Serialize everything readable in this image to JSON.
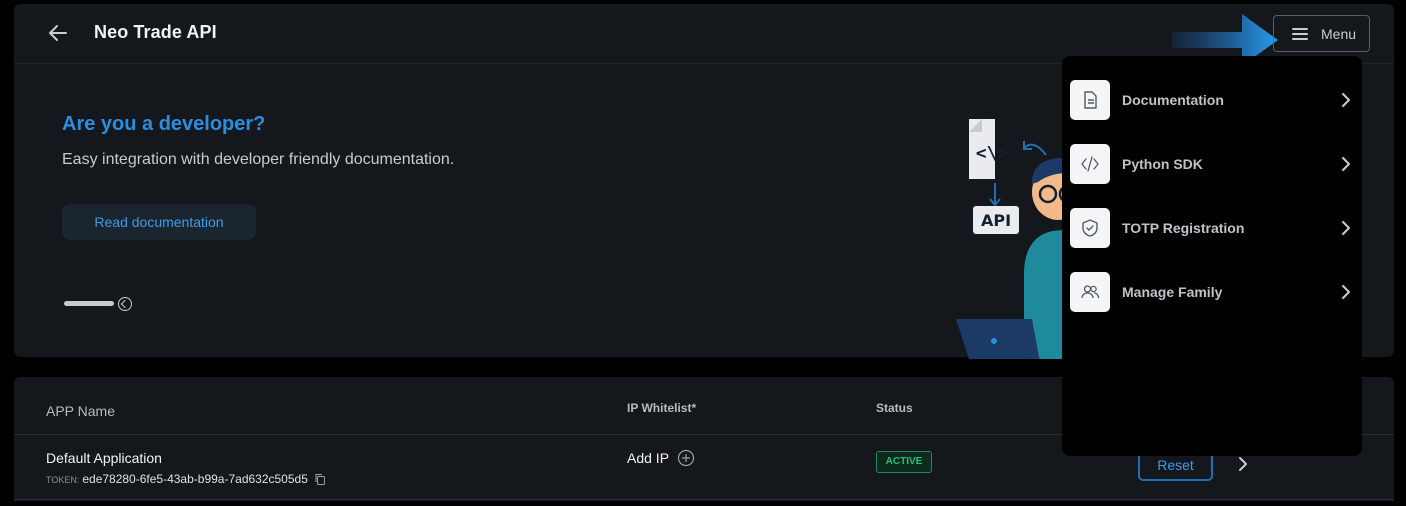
{
  "header": {
    "title": "Neo Trade API",
    "back_icon": "arrow-left-icon",
    "menu_label": "Menu"
  },
  "banner": {
    "title": "Are you a developer?",
    "subtitle": "Easy integration with developer friendly documentation.",
    "button_label": "Read documentation",
    "illustration_code_label": "<\\>",
    "illustration_api_label": "API"
  },
  "menu": {
    "items": [
      {
        "label": "Documentation",
        "icon": "document-icon"
      },
      {
        "label": "Python SDK",
        "icon": "code-icon"
      },
      {
        "label": "TOTP Registration",
        "icon": "shield-icon"
      },
      {
        "label": "Manage Family",
        "icon": "users-icon"
      }
    ]
  },
  "table": {
    "headers": {
      "app_name": "APP Name",
      "ip_whitelist": "IP Whitelist*",
      "status": "Status"
    },
    "rows": [
      {
        "app_name": "Default Application",
        "token_label": "TOKEN:",
        "token": "ede78280-6fe5-43ab-b99a-7ad632c505d5",
        "ip_action": "Add IP",
        "status": "ACTIVE",
        "action_label": "Reset"
      }
    ]
  },
  "colors": {
    "accent": "#2a8ee0",
    "status_active": "#27c07a",
    "background": "#000000",
    "card": "#14171b"
  }
}
